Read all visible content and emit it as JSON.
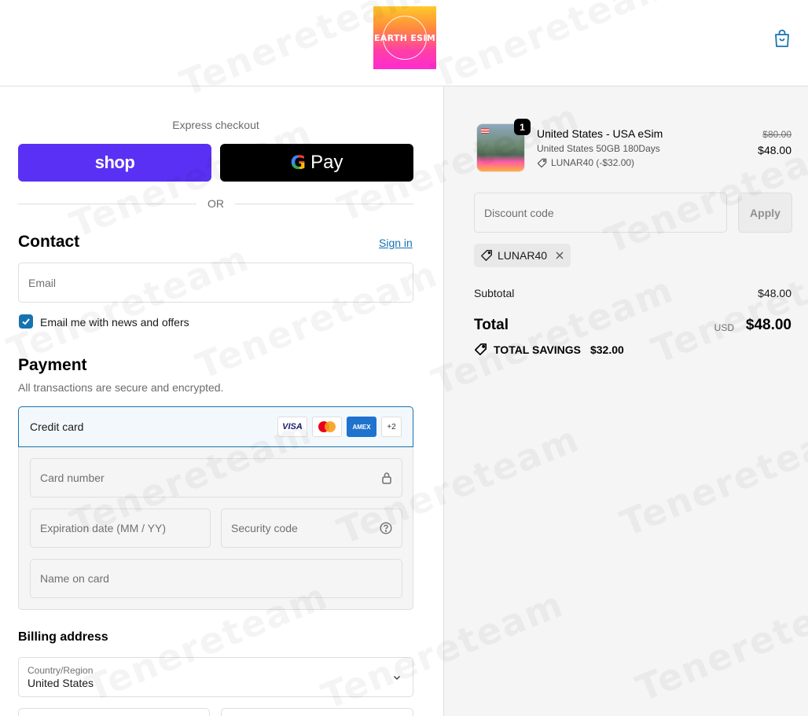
{
  "brand": {
    "logo_text": "EARTH ESIM"
  },
  "express": {
    "title": "Express checkout",
    "shop_label": "shop",
    "gpay_label": "Pay",
    "or_label": "OR"
  },
  "contact": {
    "heading": "Contact",
    "signin": "Sign in",
    "email_placeholder": "Email",
    "newsletter_label": "Email me with news and offers",
    "newsletter_checked": true
  },
  "payment": {
    "heading": "Payment",
    "subtitle": "All transactions are secure and encrypted.",
    "method_label": "Credit card",
    "card_brands": [
      "VISA",
      "mastercard",
      "AMEX",
      "+2"
    ],
    "card_number_placeholder": "Card number",
    "expiry_placeholder": "Expiration date (MM / YY)",
    "security_placeholder": "Security code",
    "name_placeholder": "Name on card"
  },
  "billing": {
    "heading": "Billing address",
    "country_label": "Country/Region",
    "country_value": "United States"
  },
  "order": {
    "item": {
      "quantity": "1",
      "title": "United States - USA eSim",
      "variant": "United States 50GB 180Days",
      "discount_line": "LUNAR40 (-$32.00)",
      "original_price": "$80.00",
      "price": "$48.00"
    },
    "discount_placeholder": "Discount code",
    "apply_label": "Apply",
    "applied_code": "LUNAR40",
    "subtotal_label": "Subtotal",
    "subtotal_value": "$48.00",
    "total_label": "Total",
    "currency": "USD",
    "total_value": "$48.00",
    "savings_label": "TOTAL SAVINGS",
    "savings_value": "$32.00"
  },
  "watermark": "Tenereteam",
  "colors": {
    "shop_purple": "#5a31f4",
    "link_blue": "#1773b0",
    "gpay_black": "#000000",
    "summary_bg": "#f5f5f5"
  }
}
